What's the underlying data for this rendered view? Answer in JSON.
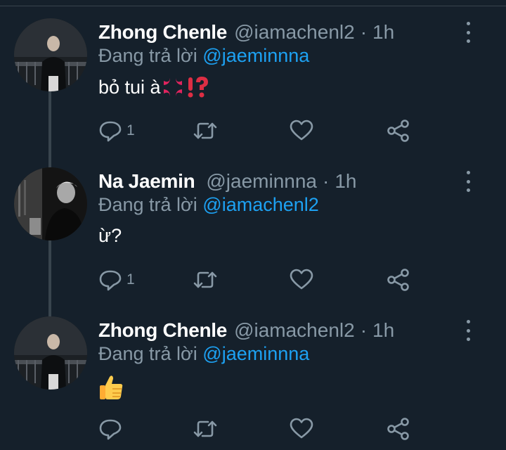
{
  "tweets": [
    {
      "author_name": "Zhong Chenle",
      "handle": "@iamachenl2",
      "separator": "·",
      "time": "1h",
      "replying_prefix": "Đang trả lời",
      "replying_to": "@jaeminnna",
      "text": "bỏ tui à",
      "emoji": [
        "anger-symbol",
        "exclamation-question-mark"
      ],
      "reply_count": "1",
      "thread_line_below": true
    },
    {
      "author_name": "Na Jaemin",
      "handle": "@jaeminnna",
      "separator": "·",
      "time": "1h",
      "replying_prefix": "Đang trả lời",
      "replying_to": "@iamachenl2",
      "text": "ừ?",
      "emoji": [],
      "reply_count": "1",
      "thread_line_below": true
    },
    {
      "author_name": "Zhong Chenle",
      "handle": "@iamachenl2",
      "separator": "·",
      "time": "1h",
      "replying_prefix": "Đang trả lời",
      "replying_to": "@jaeminnna",
      "text": "",
      "emoji": [
        "thumbs-up"
      ],
      "reply_count": "",
      "thread_line_below": false
    }
  ],
  "icons": {
    "reply": "reply-icon",
    "retweet": "retweet-icon",
    "like": "heart-icon",
    "share": "share-icon",
    "more": "more-vertical-icon"
  },
  "colors": {
    "background": "#15202b",
    "text": "#ffffff",
    "secondary": "#8899a6",
    "mention": "#1da1f2",
    "thread_line": "#38444d"
  }
}
